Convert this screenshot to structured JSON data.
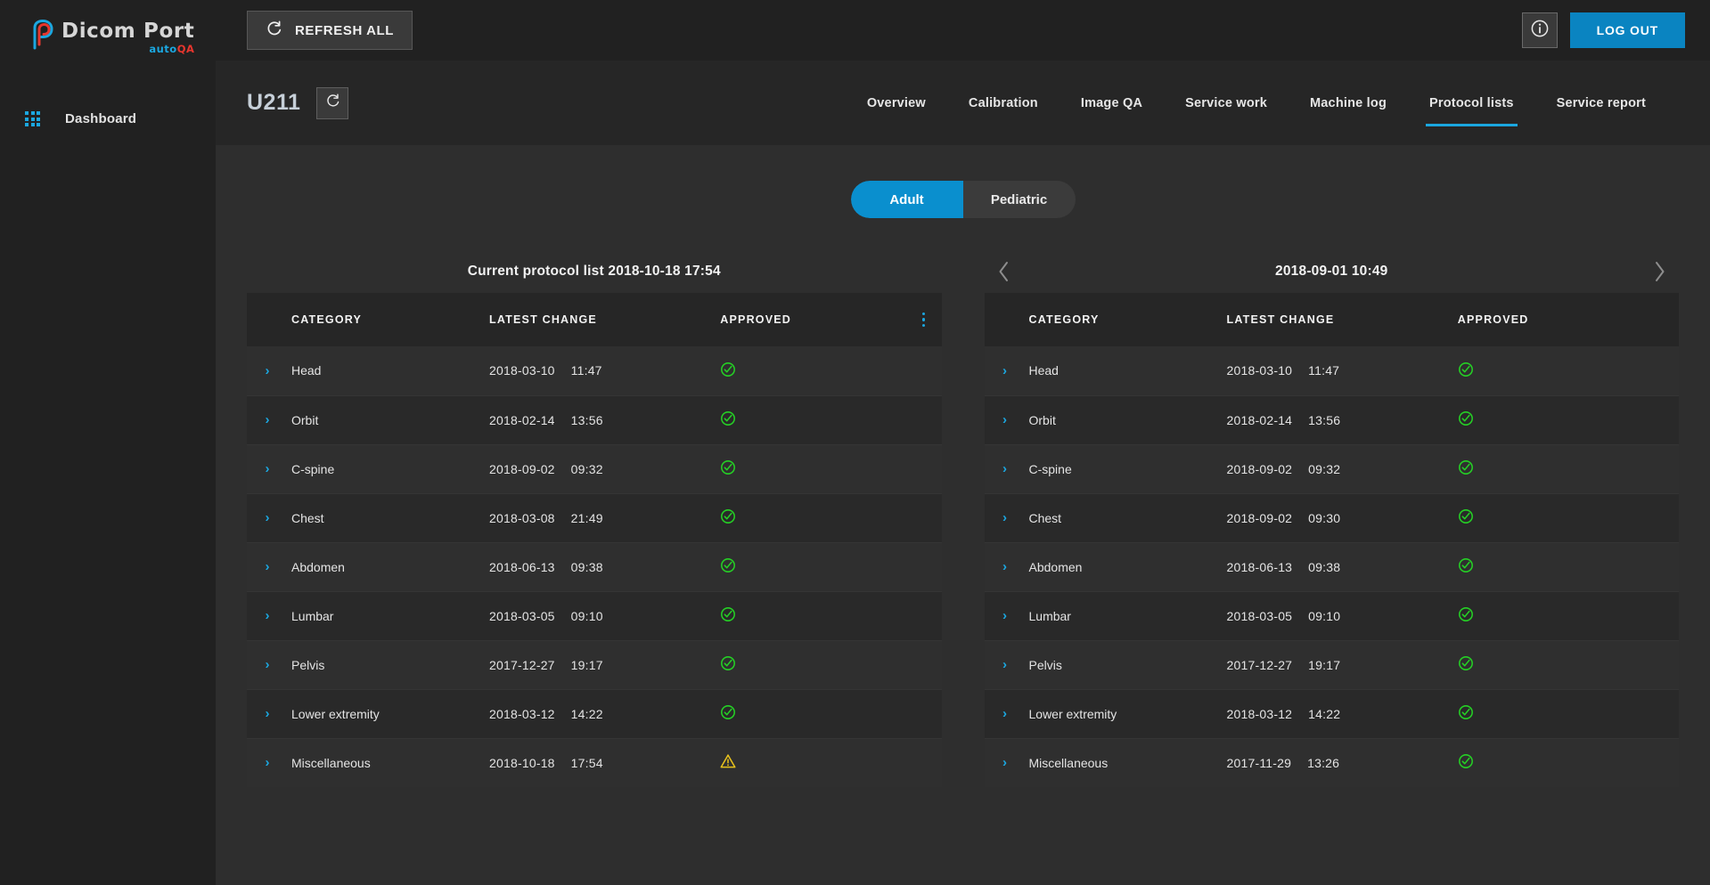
{
  "brand": {
    "name": "Dicom Port",
    "sub_auto": "auto",
    "sub_qa": "QA"
  },
  "sidebar": {
    "dashboard_label": "Dashboard"
  },
  "topbar": {
    "refresh_all_label": "REFRESH ALL",
    "logout_label": "LOG OUT"
  },
  "subbar": {
    "machine_id": "U211",
    "tabs": [
      {
        "label": "Overview",
        "active": false
      },
      {
        "label": "Calibration",
        "active": false
      },
      {
        "label": "Image QA",
        "active": false
      },
      {
        "label": "Service work",
        "active": false
      },
      {
        "label": "Machine log",
        "active": false
      },
      {
        "label": "Protocol lists",
        "active": true
      },
      {
        "label": "Service report",
        "active": false
      }
    ]
  },
  "segmented": {
    "adult_label": "Adult",
    "pediatric_label": "Pediatric",
    "selected": "Adult"
  },
  "columns": {
    "category": "CATEGORY",
    "latest_change": "LATEST CHANGE",
    "approved": "APPROVED"
  },
  "colors": {
    "accent_blue": "#1ba7e0",
    "button_blue": "#0a84c1",
    "approved_green": "#25d125",
    "warning_yellow": "#e8c21c",
    "sidebar_bg": "#212121",
    "header_bg": "#262626",
    "content_bg": "#2e2e2e"
  },
  "left_panel": {
    "title": "Current protocol list 2018-10-18 17:54",
    "rows": [
      {
        "category": "Head",
        "date": "2018-03-10",
        "time": "11:47",
        "approved": "approved"
      },
      {
        "category": "Orbit",
        "date": "2018-02-14",
        "time": "13:56",
        "approved": "approved"
      },
      {
        "category": "C-spine",
        "date": "2018-09-02",
        "time": "09:32",
        "approved": "approved"
      },
      {
        "category": "Chest",
        "date": "2018-03-08",
        "time": "21:49",
        "approved": "approved"
      },
      {
        "category": "Abdomen",
        "date": "2018-06-13",
        "time": "09:38",
        "approved": "approved"
      },
      {
        "category": "Lumbar",
        "date": "2018-03-05",
        "time": "09:10",
        "approved": "approved"
      },
      {
        "category": "Pelvis",
        "date": "2017-12-27",
        "time": "19:17",
        "approved": "approved"
      },
      {
        "category": "Lower extremity",
        "date": "2018-03-12",
        "time": "14:22",
        "approved": "approved"
      },
      {
        "category": "Miscellaneous",
        "date": "2018-10-18",
        "time": "17:54",
        "approved": "warning"
      }
    ]
  },
  "right_panel": {
    "title": "2018-09-01 10:49",
    "rows": [
      {
        "category": "Head",
        "date": "2018-03-10",
        "time": "11:47",
        "approved": "approved"
      },
      {
        "category": "Orbit",
        "date": "2018-02-14",
        "time": "13:56",
        "approved": "approved"
      },
      {
        "category": "C-spine",
        "date": "2018-09-02",
        "time": "09:32",
        "approved": "approved"
      },
      {
        "category": "Chest",
        "date": "2018-09-02",
        "time": "09:30",
        "approved": "approved"
      },
      {
        "category": "Abdomen",
        "date": "2018-06-13",
        "time": "09:38",
        "approved": "approved"
      },
      {
        "category": "Lumbar",
        "date": "2018-03-05",
        "time": "09:10",
        "approved": "approved"
      },
      {
        "category": "Pelvis",
        "date": "2017-12-27",
        "time": "19:17",
        "approved": "approved"
      },
      {
        "category": "Lower extremity",
        "date": "2018-03-12",
        "time": "14:22",
        "approved": "approved"
      },
      {
        "category": "Miscellaneous",
        "date": "2017-11-29",
        "time": "13:26",
        "approved": "approved"
      }
    ]
  }
}
